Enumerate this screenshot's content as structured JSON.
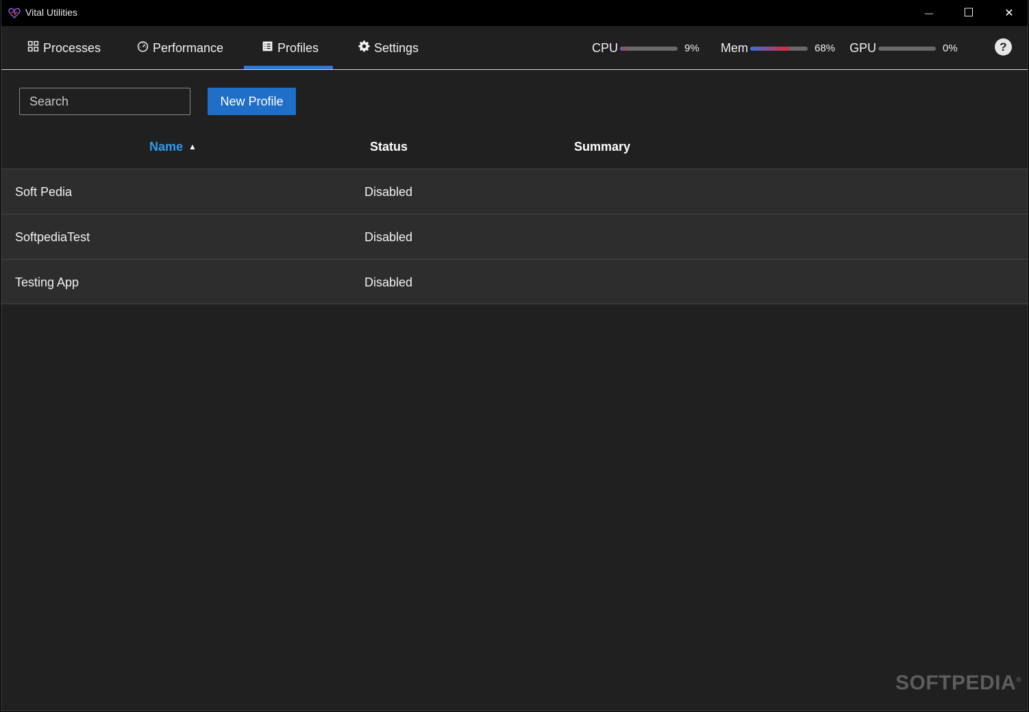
{
  "window": {
    "title": "Vital Utilities",
    "controls": {
      "minimize": "—",
      "maximize": "☐",
      "close": "✕"
    }
  },
  "nav": {
    "tabs": [
      {
        "label": "Processes",
        "icon": "grid-icon"
      },
      {
        "label": "Performance",
        "icon": "gauge-icon"
      },
      {
        "label": "Profiles",
        "icon": "list-icon",
        "active": true
      },
      {
        "label": "Settings",
        "icon": "gear-icon"
      }
    ],
    "meters": {
      "cpu": {
        "label": "CPU",
        "value": "9%",
        "level": 0.09
      },
      "mem": {
        "label": "Mem",
        "value": "68%",
        "level": 0.68
      },
      "gpu": {
        "label": "GPU",
        "value": "0%",
        "level": 0.0
      }
    },
    "help": "?"
  },
  "toolbar": {
    "search_placeholder": "Search",
    "new_profile_label": "New Profile"
  },
  "table": {
    "columns": {
      "name": "Name",
      "status": "Status",
      "summary": "Summary"
    },
    "sort_indicator": "▲",
    "rows": [
      {
        "name": "Soft Pedia",
        "status": "Disabled",
        "summary": ""
      },
      {
        "name": "SoftpediaTest",
        "status": "Disabled",
        "summary": ""
      },
      {
        "name": "Testing App",
        "status": "Disabled",
        "summary": ""
      }
    ]
  },
  "watermark": {
    "text": "SOFTPEDIA",
    "mark": "®"
  },
  "colors": {
    "accent": "#2e79d1",
    "header_active": "#2e9bf0",
    "button": "#1f6fc8",
    "background": "#202020",
    "row": "#2d2d2d"
  }
}
